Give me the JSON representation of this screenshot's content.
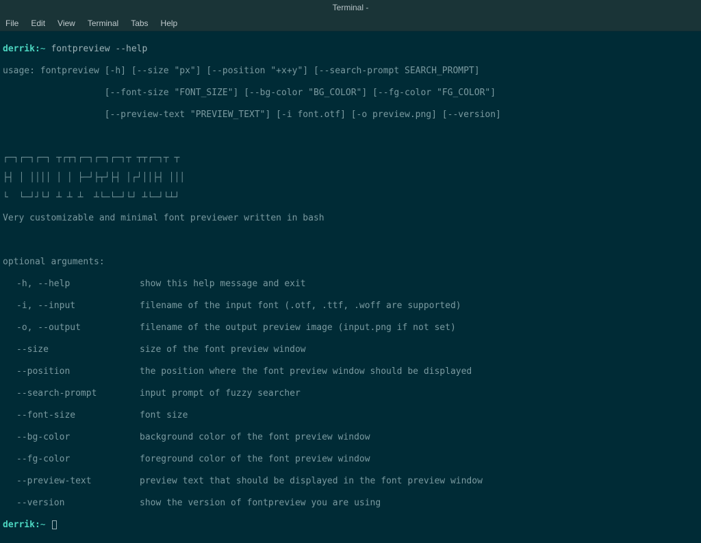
{
  "window": {
    "title": "Terminal -"
  },
  "menubar": {
    "file": "File",
    "edit": "Edit",
    "view": "View",
    "terminal": "Terminal",
    "tabs": "Tabs",
    "help": "Help"
  },
  "prompt": {
    "host": "derrik:",
    "tilde": "~",
    "command": "fontpreview --help"
  },
  "usage": {
    "line1": "usage: fontpreview [-h] [--size \"px\"] [--position \"+x+y\"] [--search-prompt SEARCH_PROMPT]",
    "line2": "                   [--font-size \"FONT_SIZE\"] [--bg-color \"BG_COLOR\"] [--fg-color \"FG_COLOR\"]",
    "line3": "                   [--preview-text \"PREVIEW_TEXT\"] [-i font.otf] [-o preview.png] [--version]"
  },
  "figlet": [
    "┌─┐┌─┐┌─┐ ┬┌┬┐┌─┐┌─┐┌─┐┬ ┬┬┌─┐┬ ┬",
    "├┤ │ ││││ │ │ ├─┘├┬┘├┤ │┌┘││├┤ │││",
    "└  └─┘┘└┘ ┴ ┴ ┴  ┴└─└─┘└┘ ┴└─┘└┴┘"
  ],
  "tagline": "Very customizable and minimal font previewer written in bash",
  "args_header": "optional arguments:",
  "args": [
    {
      "flag": "-h, --help",
      "desc": "show this help message and exit"
    },
    {
      "flag": "-i, --input",
      "desc": "filename of the input font (.otf, .ttf, .woff are supported)"
    },
    {
      "flag": "-o, --output",
      "desc": "filename of the output preview image (input.png if not set)"
    },
    {
      "flag": "--size",
      "desc": "size of the font preview window"
    },
    {
      "flag": "--position",
      "desc": "the position where the font preview window should be displayed"
    },
    {
      "flag": "--search-prompt",
      "desc": "input prompt of fuzzy searcher"
    },
    {
      "flag": "--font-size",
      "desc": "font size"
    },
    {
      "flag": "--bg-color",
      "desc": "background color of the font preview window"
    },
    {
      "flag": "--fg-color",
      "desc": "foreground color of the font preview window"
    },
    {
      "flag": "--preview-text",
      "desc": "preview text that should be displayed in the font preview window"
    },
    {
      "flag": "--version",
      "desc": "show the version of fontpreview you are using"
    }
  ],
  "prompt2": {
    "host": "derrik:",
    "tilde": "~"
  }
}
